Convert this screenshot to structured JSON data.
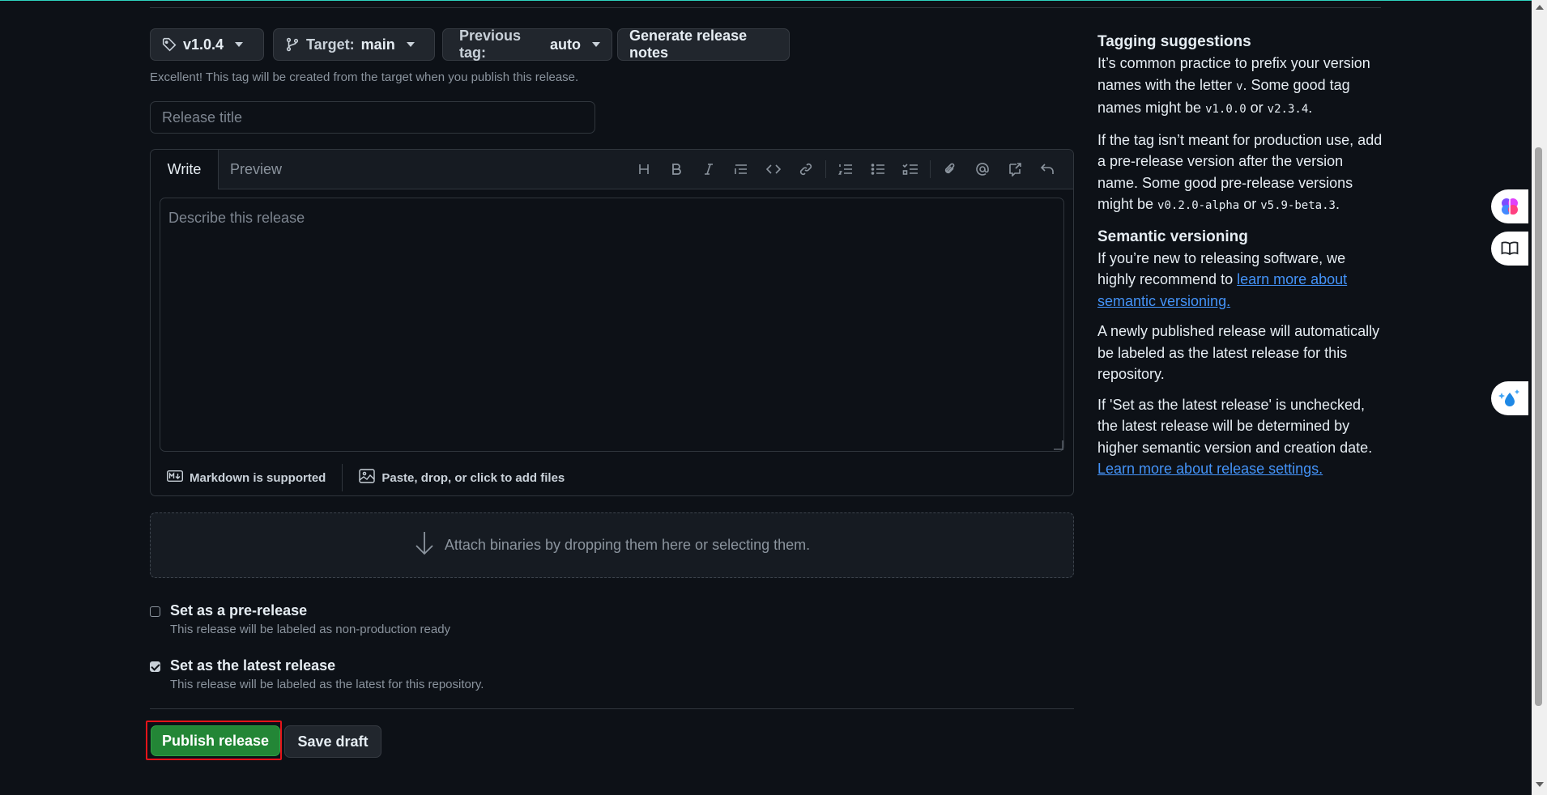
{
  "release_form": {
    "tag_button": {
      "label": "v1.0.4",
      "icon": "tag-icon"
    },
    "target_button": {
      "prefix": "Target:",
      "value": "main",
      "icon": "branch-icon"
    },
    "previous_tag_button": {
      "prefix": "Previous tag:",
      "value": "auto"
    },
    "generate_notes_button": {
      "label": "Generate release notes"
    },
    "tag_hint": "Excellent! This tag will be created from the target when you publish this release.",
    "title_input": {
      "placeholder": "Release title",
      "value": ""
    },
    "editor": {
      "tabs": [
        {
          "label": "Write",
          "active": true
        },
        {
          "label": "Preview",
          "active": false
        }
      ],
      "toolbar": [
        "heading-icon",
        "bold-icon",
        "italic-icon",
        "quote-icon",
        "code-icon",
        "link-icon",
        "ordered-list-icon",
        "unordered-list-icon",
        "task-list-icon",
        "attach-icon",
        "mention-icon",
        "reference-icon",
        "undo-icon"
      ],
      "description_placeholder": "Describe this release",
      "markdown_label": "Markdown is supported",
      "files_label": "Paste, drop, or click to add files"
    },
    "attach_binaries": "Attach binaries by dropping them here or selecting them.",
    "prerelease": {
      "label": "Set as a pre-release",
      "description": "This release will be labeled as non-production ready",
      "checked": false
    },
    "latest": {
      "label": "Set as the latest release",
      "description": "This release will be labeled as the latest for this repository.",
      "checked": true
    },
    "publish_button": "Publish release",
    "save_draft_button": "Save draft"
  },
  "sidebar": {
    "tagging_title": "Tagging suggestions",
    "tagging_p1_a": "It’s common practice to prefix your version names with the letter ",
    "tagging_p1_code1": "v",
    "tagging_p1_b": ". Some good tag names might be ",
    "tagging_p1_code2": "v1.0.0",
    "tagging_p1_c": " or ",
    "tagging_p1_code3": "v2.3.4",
    "tagging_p1_d": ".",
    "tagging_p2_a": "If the tag isn’t meant for production use, add a pre-release version after the version name. Some good pre-release versions might be ",
    "tagging_p2_code1": "v0.2.0-alpha",
    "tagging_p2_b": " or ",
    "tagging_p2_code2": "v5.9-beta.3",
    "tagging_p2_c": ".",
    "semver_title": "Semantic versioning",
    "semver_p1_a": "If you’re new to releasing software, we highly recommend to ",
    "semver_p1_link": "learn more about semantic versioning.",
    "semver_p2": "A newly published release will automatically be labeled as the latest release for this repository.",
    "semver_p3_a": "If 'Set as the latest release' is unchecked, the latest release will be determined by higher semantic version and creation date. ",
    "semver_p3_link": "Learn more about release settings."
  },
  "floating": [
    "brain-icon",
    "book-icon",
    "sparkle-drop-icon"
  ],
  "colors": {
    "background": "#0d1117",
    "publish": "#238636",
    "link": "#4493f8",
    "highlight": "#e5141a"
  }
}
